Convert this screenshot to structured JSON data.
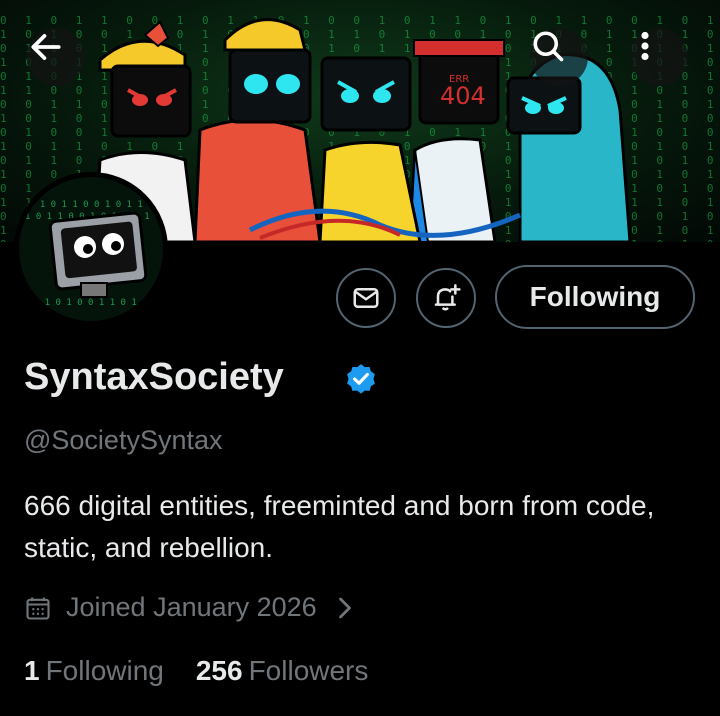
{
  "profile": {
    "display_name": "SyntaxSociety",
    "handle": "@SocietySyntax",
    "bio": "666 digital entities, freeminted and born from code, static, and rebellion.",
    "joined": "Joined January 2026",
    "following_count": "1",
    "following_label": "Following",
    "followers_count": "256",
    "followers_label": "Followers",
    "verified": true
  },
  "banner": {
    "err_label": "ERR",
    "err_code": "404"
  },
  "actions": {
    "follow_label": "Following"
  },
  "colors": {
    "background": "#000000",
    "primary_text": "#e7e9ea",
    "secondary_text": "#71767b",
    "verified_blue": "#1d9bf0",
    "button_border": "#536471",
    "matrix_green": "#1fbf52"
  },
  "icons": [
    "back-arrow-icon",
    "search-icon",
    "more-vertical-icon",
    "mail-icon",
    "bell-plus-icon",
    "verified-badge-icon",
    "calendar-icon",
    "chevron-right-icon"
  ]
}
